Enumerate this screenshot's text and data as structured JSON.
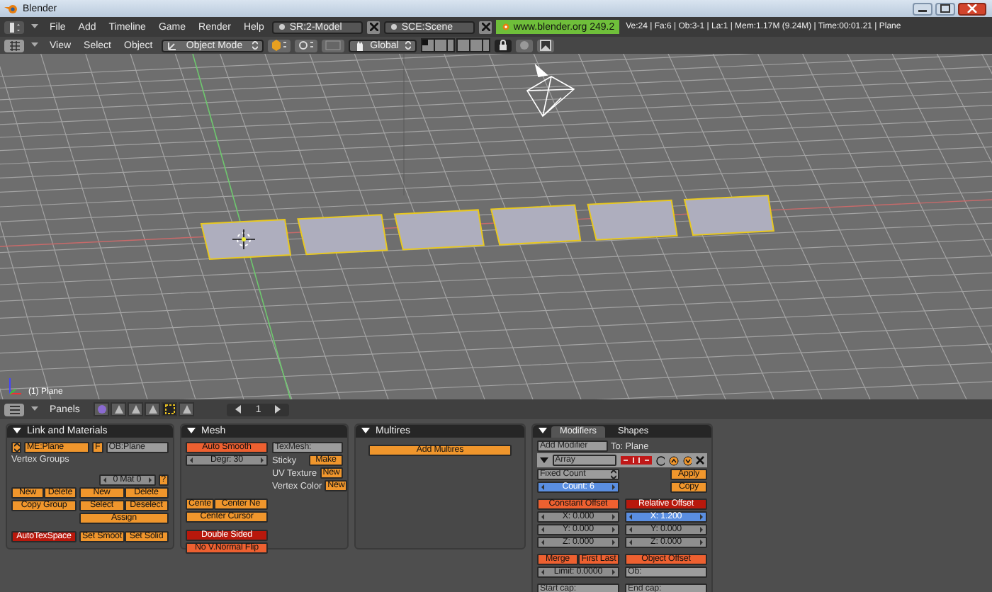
{
  "window": {
    "title": "Blender"
  },
  "menu_bar": {
    "menus": [
      "File",
      "Add",
      "Timeline",
      "Game",
      "Render",
      "Help"
    ],
    "screen": "SR:2-Model",
    "scene": "SCE:Scene",
    "version_badge": "www.blender.org 249.2",
    "stats": "Ve:24 | Fa:6 | Ob:3-1 | La:1  | Mem:1.17M (9.24M)  | Time:00:01.21 | Plane"
  },
  "view_header": {
    "menus": [
      "View",
      "Select",
      "Object"
    ],
    "mode": "Object Mode",
    "orientation": "Global",
    "layers": [
      {
        "on": true
      },
      {
        "on": false
      },
      {
        "on": false
      },
      {
        "on": false
      },
      {
        "on": false
      },
      {
        "on": false
      },
      {
        "on": false
      },
      {
        "on": false
      },
      {
        "on": false
      },
      {
        "on": false
      },
      {
        "on": false
      },
      {
        "on": false
      },
      {
        "on": false
      },
      {
        "on": false
      },
      {
        "on": false
      },
      {
        "on": false
      },
      {
        "on": false
      },
      {
        "on": false
      },
      {
        "on": false
      },
      {
        "on": false
      }
    ]
  },
  "viewport": {
    "object_label": "(1) Plane"
  },
  "buttons_header": {
    "label": "Panels",
    "context_icons": [
      {
        "selected": false
      },
      {
        "selected": false
      },
      {
        "selected": false
      },
      {
        "selected": false
      },
      {
        "selected": true
      },
      {
        "selected": false
      }
    ],
    "page": "1"
  },
  "link_materials": {
    "title": "Link and Materials",
    "mesh_field": "ME:Plane",
    "fake_user": "F",
    "object_field": "OB:Plane",
    "vertex_groups_label": "Vertex Groups",
    "material_index": "0 Mat 0",
    "material_query": "?",
    "group_buttons": [
      "New",
      "Delete",
      "Copy Group"
    ],
    "material_buttons": [
      "New",
      "Delete",
      "Select",
      "Deselect",
      "Assign"
    ],
    "autotexspace": {
      "label": "AutoTexSpace",
      "on": true
    },
    "smooth_buttons": [
      "Set Smoot",
      "Set Solid"
    ]
  },
  "mesh": {
    "title": "Mesh",
    "auto_smooth": {
      "label": "Auto Smooth",
      "on": false
    },
    "degree": "Degr: 30",
    "texmesh": "TexMesh:",
    "layer_rows": [
      {
        "label": "Sticky",
        "button": "Make"
      },
      {
        "label": "UV Texture",
        "button": "New"
      },
      {
        "label": "Vertex Color",
        "button": "New"
      }
    ],
    "center_buttons": [
      "Cente",
      "Center Ne",
      "Center Cursor"
    ],
    "double_sided": {
      "label": "Double Sided",
      "on": true
    },
    "normal_flip": {
      "label": "No V.Normal Flip",
      "on": false
    }
  },
  "multires": {
    "title": "Multires",
    "add_button": "Add Multires"
  },
  "modifiers": {
    "tabs": [
      {
        "label": "Modifiers",
        "selected": true
      },
      {
        "label": "Shapes",
        "selected": false
      }
    ],
    "add_modifier": "Add Modifier",
    "to_label": "To: Plane",
    "modifier_name": "Array",
    "expanded": true,
    "fit_type": "Fixed Count",
    "count": {
      "text": "Count: 6",
      "highlighted": true
    },
    "apply": "Apply",
    "copy": "Copy",
    "constant_offset": {
      "label": "Constant Offset",
      "on": false
    },
    "relative_offset": {
      "label": "Relative Offset",
      "on": true
    },
    "constant_values": [
      {
        "text": "X: 0.000",
        "highlighted": false
      },
      {
        "text": "Y: 0.000",
        "highlighted": false
      },
      {
        "text": "Z: 0.000",
        "highlighted": false
      }
    ],
    "relative_values": [
      {
        "text": "X: 1.200",
        "highlighted": true
      },
      {
        "text": "Y: 0.000",
        "highlighted": false
      },
      {
        "text": "Z: 0.000",
        "highlighted": false
      }
    ],
    "merge": {
      "label": "Merge",
      "on": false
    },
    "first_last": {
      "label": "First Last",
      "on": false
    },
    "object_offset": {
      "label": "Object Offset",
      "on": false
    },
    "limit": "Limit: 0.0000",
    "offset_object": "Ob:",
    "start_cap": "Start cap:",
    "end_cap": "End cap:"
  }
}
